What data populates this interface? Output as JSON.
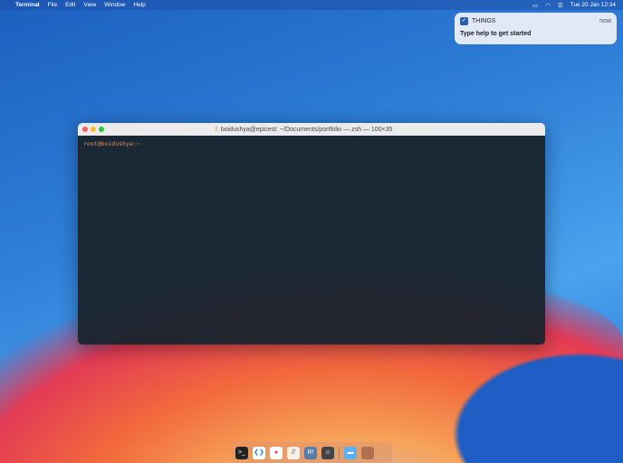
{
  "menubar": {
    "app": "Terminal",
    "items": [
      "File",
      "Edit",
      "View",
      "Window",
      "Help"
    ],
    "clock": "Tue 20 Jan  12:34"
  },
  "notification": {
    "app": "THINGS",
    "time": "now",
    "message": "Type help to get started"
  },
  "terminal": {
    "title": "boidushya@epicest: ~/Documents/portfolio — zsh — 100×35",
    "prompt": "root@boidushya:~"
  },
  "dock": [
    "terminal",
    "vscode",
    "music",
    "script-editor",
    "r-app",
    "avatar",
    "finder-folder",
    "folder"
  ]
}
